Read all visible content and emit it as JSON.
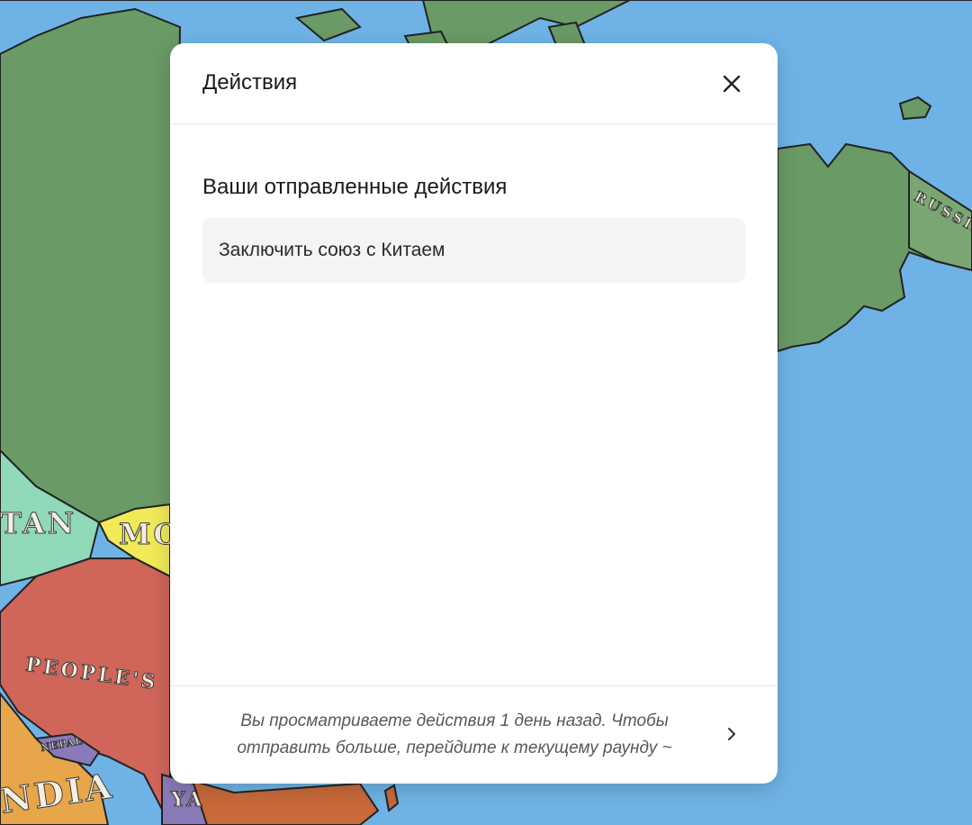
{
  "dialog": {
    "title": "Действия",
    "close_icon": "close-icon",
    "section_title": "Ваши отправленные действия",
    "actions": [
      {
        "label": "Заключить союз с Китаем"
      }
    ],
    "footer_text": "Вы просматриваете действия 1 день назад. Чтобы отправить больше, перейдите к текущему раунду ~",
    "footer_icon": "chevron-right-icon"
  },
  "map": {
    "labels": {
      "russia": "RUSSIA",
      "kazakhstan": "TAN",
      "mongolia": "MO",
      "china": "PEOPLE'S",
      "nepal": "NEPAL",
      "india": "NDIA",
      "myanmar": "YA"
    },
    "colors": {
      "ocean": "#6fb3e6",
      "russia_land": "#6a9a66",
      "kazakhstan": "#8fd9b8",
      "mongolia": "#f0ea58",
      "china": "#d0655a",
      "india": "#e8a64a",
      "nepal": "#8a7ab8"
    }
  }
}
